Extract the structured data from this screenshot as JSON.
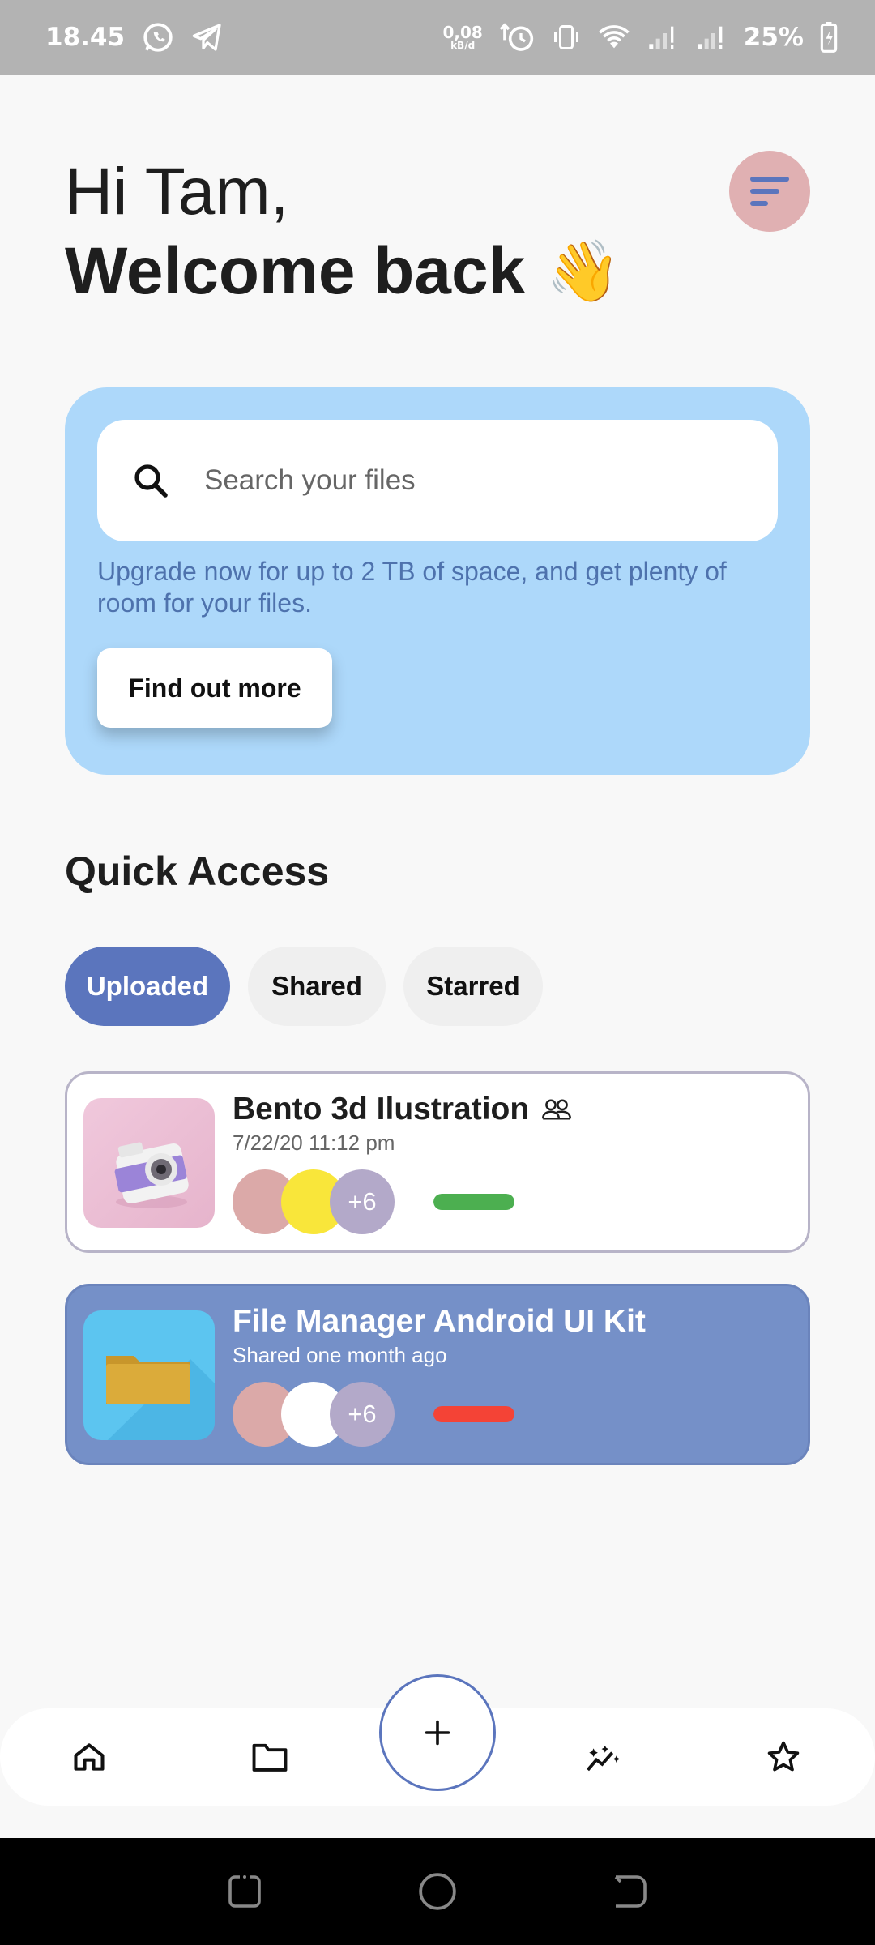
{
  "status_bar": {
    "time": "18.45",
    "net_speed_value": "0,08",
    "net_speed_unit": "kB/d",
    "battery": "25%"
  },
  "greeting": {
    "line1": "Hi Tam,",
    "line2": "Welcome back",
    "emoji": "👋"
  },
  "promo": {
    "search_placeholder": "Search your files",
    "text": "Upgrade now for up to 2 TB of space, and get plenty of room for your files.",
    "button_label": "Find out more"
  },
  "quick_access": {
    "title": "Quick Access",
    "tabs": [
      {
        "label": "Uploaded",
        "active": true
      },
      {
        "label": "Shared",
        "active": false
      },
      {
        "label": "Starred",
        "active": false
      }
    ]
  },
  "files": [
    {
      "title": "Bento 3d Ilustration",
      "subtitle": "7/22/20 11:12 pm",
      "extra_members": "+6",
      "progress": 1.0,
      "progress_color": "#4caf50",
      "icon": "camera-thumbnail"
    },
    {
      "title": "File Manager Android UI Kit",
      "subtitle": "Shared one month ago",
      "extra_members": "+6",
      "progress": 1.0,
      "progress_color": "#f44336",
      "icon": "folder-thumbnail"
    }
  ],
  "bottom_nav": {
    "items": [
      "home-icon",
      "folder-icon",
      "add-icon",
      "sparkle-icon",
      "star-icon"
    ]
  },
  "colors": {
    "accent": "#5b75bd",
    "promo_bg": "#add8fa",
    "menu_button": "#e0b0b2"
  }
}
